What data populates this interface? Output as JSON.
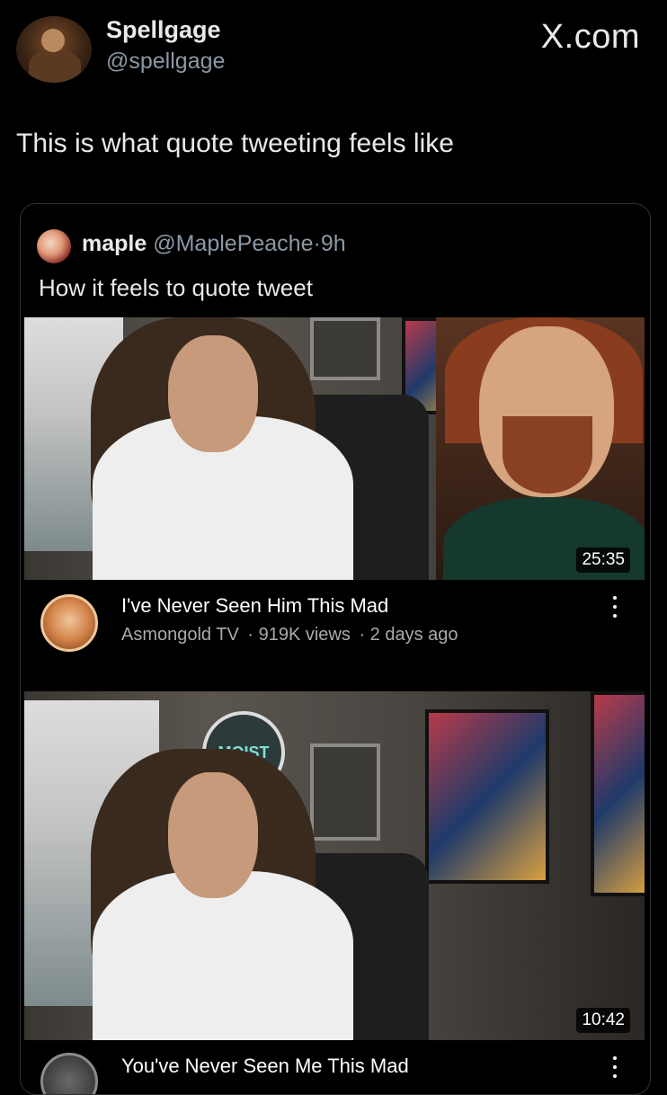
{
  "header": {
    "display_name": "Spellgage",
    "handle": "@spellgage",
    "brand": "X.com"
  },
  "tweet": {
    "text": "This is what quote tweeting feels like"
  },
  "quote": {
    "name": "maple",
    "handle": "@MaplePeache",
    "dot": "·",
    "time": "9h",
    "text": "How it feels to quote tweet"
  },
  "videos": [
    {
      "title": "I've Never Seen Him This Mad",
      "channel": "Asmongold TV",
      "views": "· 919K views",
      "age": "· 2 days ago",
      "duration": "25:35"
    },
    {
      "title": "You've Never Seen Me This Mad",
      "duration": "10:42"
    }
  ],
  "thumbnail2": {
    "sign_text": "MOIST"
  }
}
